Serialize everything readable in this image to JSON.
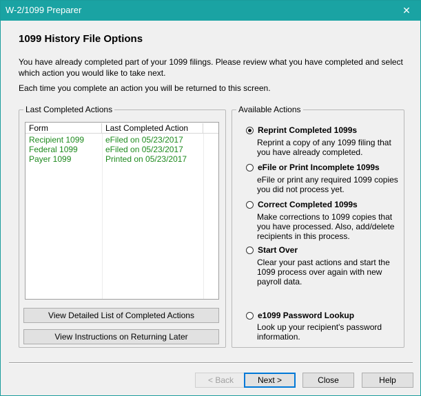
{
  "window": {
    "title": "W-2/1099 Preparer",
    "close_glyph": "✕"
  },
  "header": {
    "title": "1099 History File Options",
    "intro": "You have already completed part of your 1099 filings. Please review what you have completed and select which action you would like to take next.",
    "intro2": "Each time you complete an action you will be returned to this screen."
  },
  "left_group": {
    "label": "Last Completed Actions",
    "columns": [
      "Form",
      "Last Completed Action"
    ],
    "rows": [
      {
        "form": "Recipient 1099",
        "action": "eFiled on 05/23/2017"
      },
      {
        "form": "Federal 1099",
        "action": "eFiled on 05/23/2017"
      },
      {
        "form": "Payer 1099",
        "action": "Printed on 05/23/2017"
      }
    ],
    "btn_detailed": "View Detailed List of Completed Actions",
    "btn_instructions": "View Instructions on Returning Later"
  },
  "right_group": {
    "label": "Available Actions",
    "options": [
      {
        "label": "Reprint Completed 1099s",
        "desc": "Reprint a copy of any 1099 filing that you have already completed.",
        "checked": true
      },
      {
        "label": "eFile or Print Incomplete 1099s",
        "desc": "eFile or print any required 1099 copies you did not process yet.",
        "checked": false
      },
      {
        "label": "Correct Completed 1099s",
        "desc": "Make corrections to 1099 copies that you have processed. Also, add/delete recipients in this process.",
        "checked": false
      },
      {
        "label": "Start Over",
        "desc": "Clear your past actions and start the 1099 process over again with new payroll data.",
        "checked": false
      },
      {
        "label": "e1099 Password Lookup",
        "desc": "Look up your recipient's password information.",
        "checked": false
      }
    ]
  },
  "footer": {
    "back": "< Back",
    "next": "Next >",
    "close": "Close",
    "help": "Help"
  }
}
